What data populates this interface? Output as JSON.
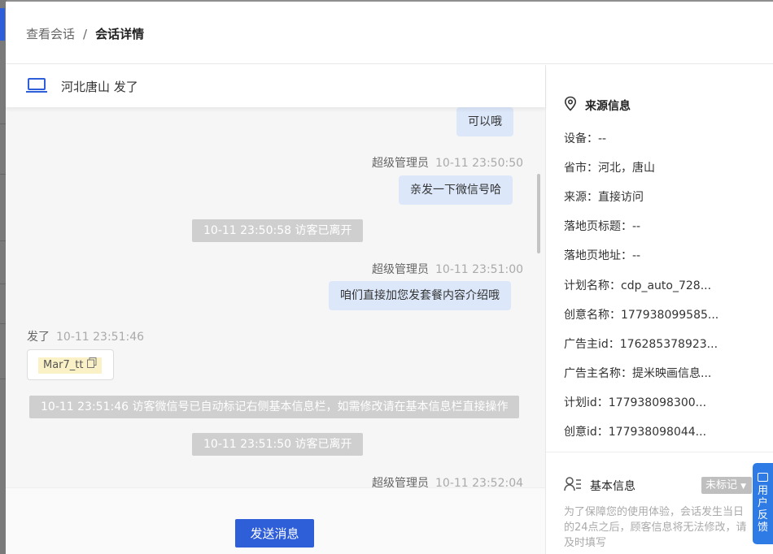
{
  "breadcrumb": {
    "parent": "查看会话",
    "separator": "/",
    "current": "会话详情"
  },
  "chat": {
    "header_title": "河北唐山   发了",
    "messages": {
      "m1_text": "可以哦",
      "m2_sender": "超级管理员",
      "m2_time": "10-11 23:50:50",
      "m2_text": "亲发一下微信号哈",
      "sys1": "10-11 23:50:58 访客已离开",
      "m3_sender": "超级管理员",
      "m3_time": "10-11 23:51:00",
      "m3_text": "咱们直接加您发套餐内容介绍哦",
      "m4_sender": "发了",
      "m4_time": "10-11 23:51:46",
      "m4_file": "Mar7_tt",
      "sys2": "10-11 23:51:46 访客微信号已自动标记右侧基本信息栏，如需修改请在基本信息栏直接操作",
      "sys3": "10-11 23:51:50 访客已离开",
      "m5_sender": "超级管理员",
      "m5_time": "10-11 23:52:04"
    },
    "send_label": "发送消息"
  },
  "info": {
    "source_title": "来源信息",
    "rows": [
      "设备：--",
      "省市：河北，唐山",
      "来源：直接访问",
      "落地页标题：--",
      "落地页地址：--",
      "计划名称：cdp_auto_728...",
      "创意名称：177938099585...",
      "广告主id：176285378923...",
      "广告主名称：提米映画信息...",
      "计划id：177938098300...",
      "创意id：177938098044..."
    ],
    "basic_title": "基本信息",
    "tag_label": "未标记",
    "note": "为了保障您的使用体验，会话发生当日的24点之后，顾客信息将无法修改，请及时填写"
  },
  "feedback_label": "用户反馈",
  "colors": {
    "primary": "#2f5fd8",
    "bubble": "#dce8fa",
    "system": "#cfcfcf",
    "feedback": "#2f7be5"
  }
}
